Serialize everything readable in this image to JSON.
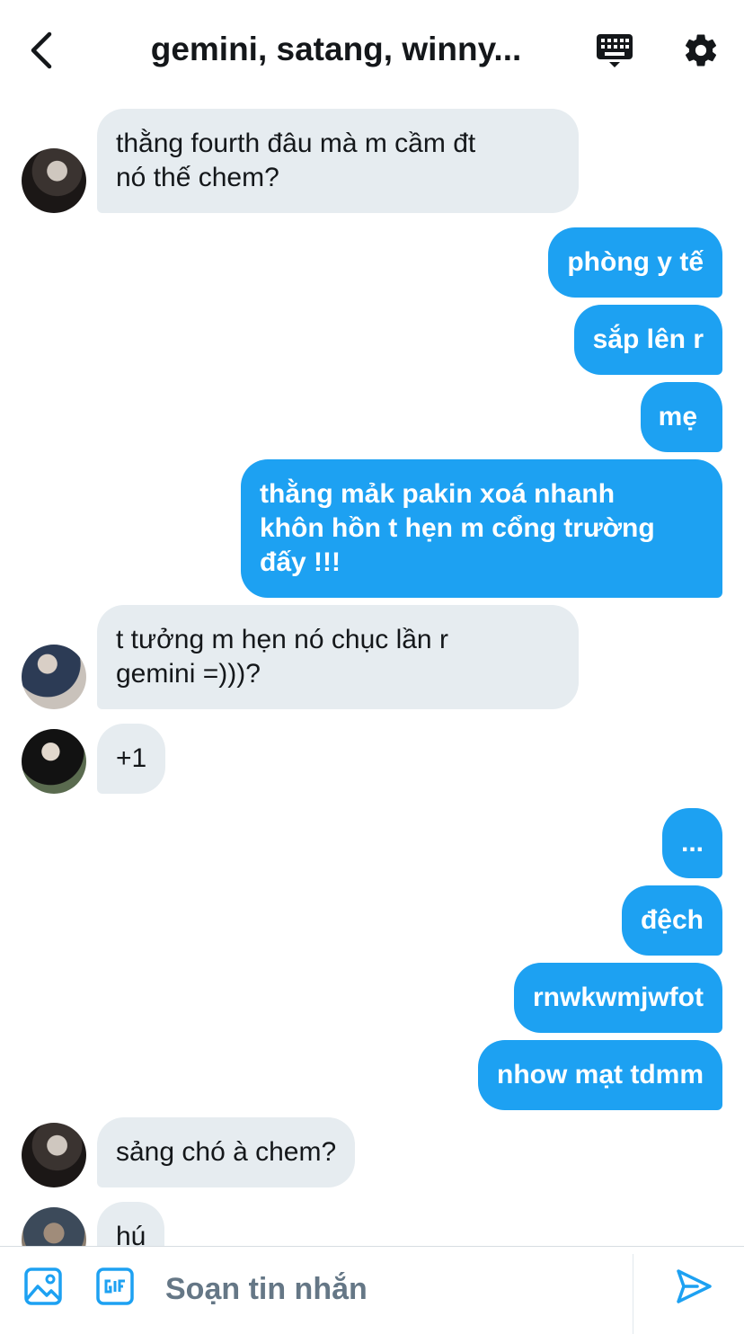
{
  "header": {
    "title": "gemini, satang, winny..."
  },
  "messages": [
    {
      "side": "in",
      "avatar": "av1",
      "lines": [
        "thằng fourth đâu mà m cầm đt",
        "nó thế chem?"
      ]
    },
    {
      "side": "out",
      "lines": [
        "phòng y tế"
      ]
    },
    {
      "side": "out",
      "lines": [
        "sắp lên r"
      ]
    },
    {
      "side": "out",
      "lines": [
        "mẹ"
      ]
    },
    {
      "side": "out",
      "lines": [
        "thằng mảk pakin xoá nhanh",
        "khôn hồn t hẹn m cổng trường",
        "đấy !!!"
      ]
    },
    {
      "side": "in",
      "avatar": "av2",
      "lines": [
        "t tưởng m hẹn nó chục lần r",
        "gemini =)))?"
      ]
    },
    {
      "side": "in",
      "avatar": "av3",
      "lines": [
        "+1"
      ]
    },
    {
      "side": "out",
      "lines": [
        "..."
      ]
    },
    {
      "side": "out",
      "lines": [
        "đệch"
      ]
    },
    {
      "side": "out",
      "lines": [
        "rnwkwmjwfot"
      ]
    },
    {
      "side": "out",
      "lines": [
        "nhow mạt tdmm"
      ]
    },
    {
      "side": "in",
      "avatar": "av1",
      "lines": [
        "sảng chó à chem?"
      ]
    },
    {
      "side": "in",
      "avatar": "av4",
      "lines": [
        "hú"
      ]
    }
  ],
  "composer": {
    "placeholder": "Soạn tin nhắn"
  },
  "icons": {
    "back": "chevron-left-icon",
    "keyboard": "keyboard-icon",
    "settings": "gear-icon",
    "image": "image-icon",
    "gif": "gif-icon",
    "send": "send-icon"
  },
  "colors": {
    "accent": "#1da1f2",
    "incoming_bubble": "#e6ecf0",
    "text": "#14171a",
    "placeholder": "#657786"
  }
}
